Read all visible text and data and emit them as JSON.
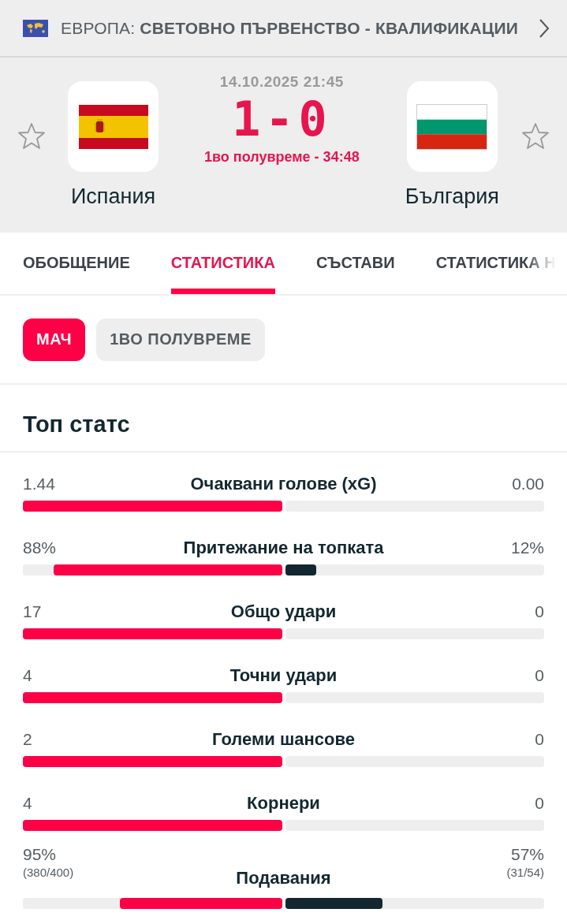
{
  "competition": {
    "region": "ЕВРОПА:",
    "name": "СВЕТОВНО ПЪРВЕНСТВО - КВАЛИФИКАЦИИ"
  },
  "match": {
    "datetime": "14.10.2025 21:45",
    "score": "1-0",
    "status": "1во полувреме - 34:48",
    "home": {
      "name": "Испания",
      "favorite": false,
      "flag": {
        "kind": "spain"
      }
    },
    "away": {
      "name": "България",
      "favorite": false,
      "flag": {
        "kind": "bulgaria"
      }
    }
  },
  "tabs": [
    {
      "label": "ОБОБЩЕНИЕ",
      "selected": false
    },
    {
      "label": "СТАТИСТИКА",
      "selected": true
    },
    {
      "label": "СЪСТАВИ",
      "selected": false
    },
    {
      "label": "СТАТИСТИКА Н",
      "selected": false
    }
  ],
  "periods": [
    {
      "label": "МАЧ",
      "selected": true
    },
    {
      "label": "1ВО ПОЛУВРЕМЕ",
      "selected": false
    }
  ],
  "section_title": "Топ статс",
  "stats": [
    {
      "label": "Очаквани голове (xG)",
      "home": {
        "value": "1.44",
        "level": 1
      },
      "away": {
        "value": "0.00"
      }
    },
    {
      "label": "Притежание на топката",
      "home": {
        "value": "88%",
        "level": 0.88
      },
      "away": {
        "value": "12%",
        "level": 0.12
      }
    },
    {
      "label": "Общо удари",
      "home": {
        "value": "17",
        "level": 1
      },
      "away": {
        "value": "0"
      }
    },
    {
      "label": "Точни удари",
      "home": {
        "value": "4",
        "level": 1
      },
      "away": {
        "value": "0"
      }
    },
    {
      "label": "Големи шансове",
      "home": {
        "value": "2",
        "level": 1
      },
      "away": {
        "value": "0"
      }
    },
    {
      "label": "Корнери",
      "home": {
        "value": "4",
        "level": 1
      },
      "away": {
        "value": "0"
      }
    },
    {
      "label": "Подавания",
      "home": {
        "value": "95%",
        "detail": "(380/400)",
        "level": 0.625
      },
      "away": {
        "value": "57%",
        "detail": "(31/54)",
        "level": 0.375
      }
    }
  ]
}
